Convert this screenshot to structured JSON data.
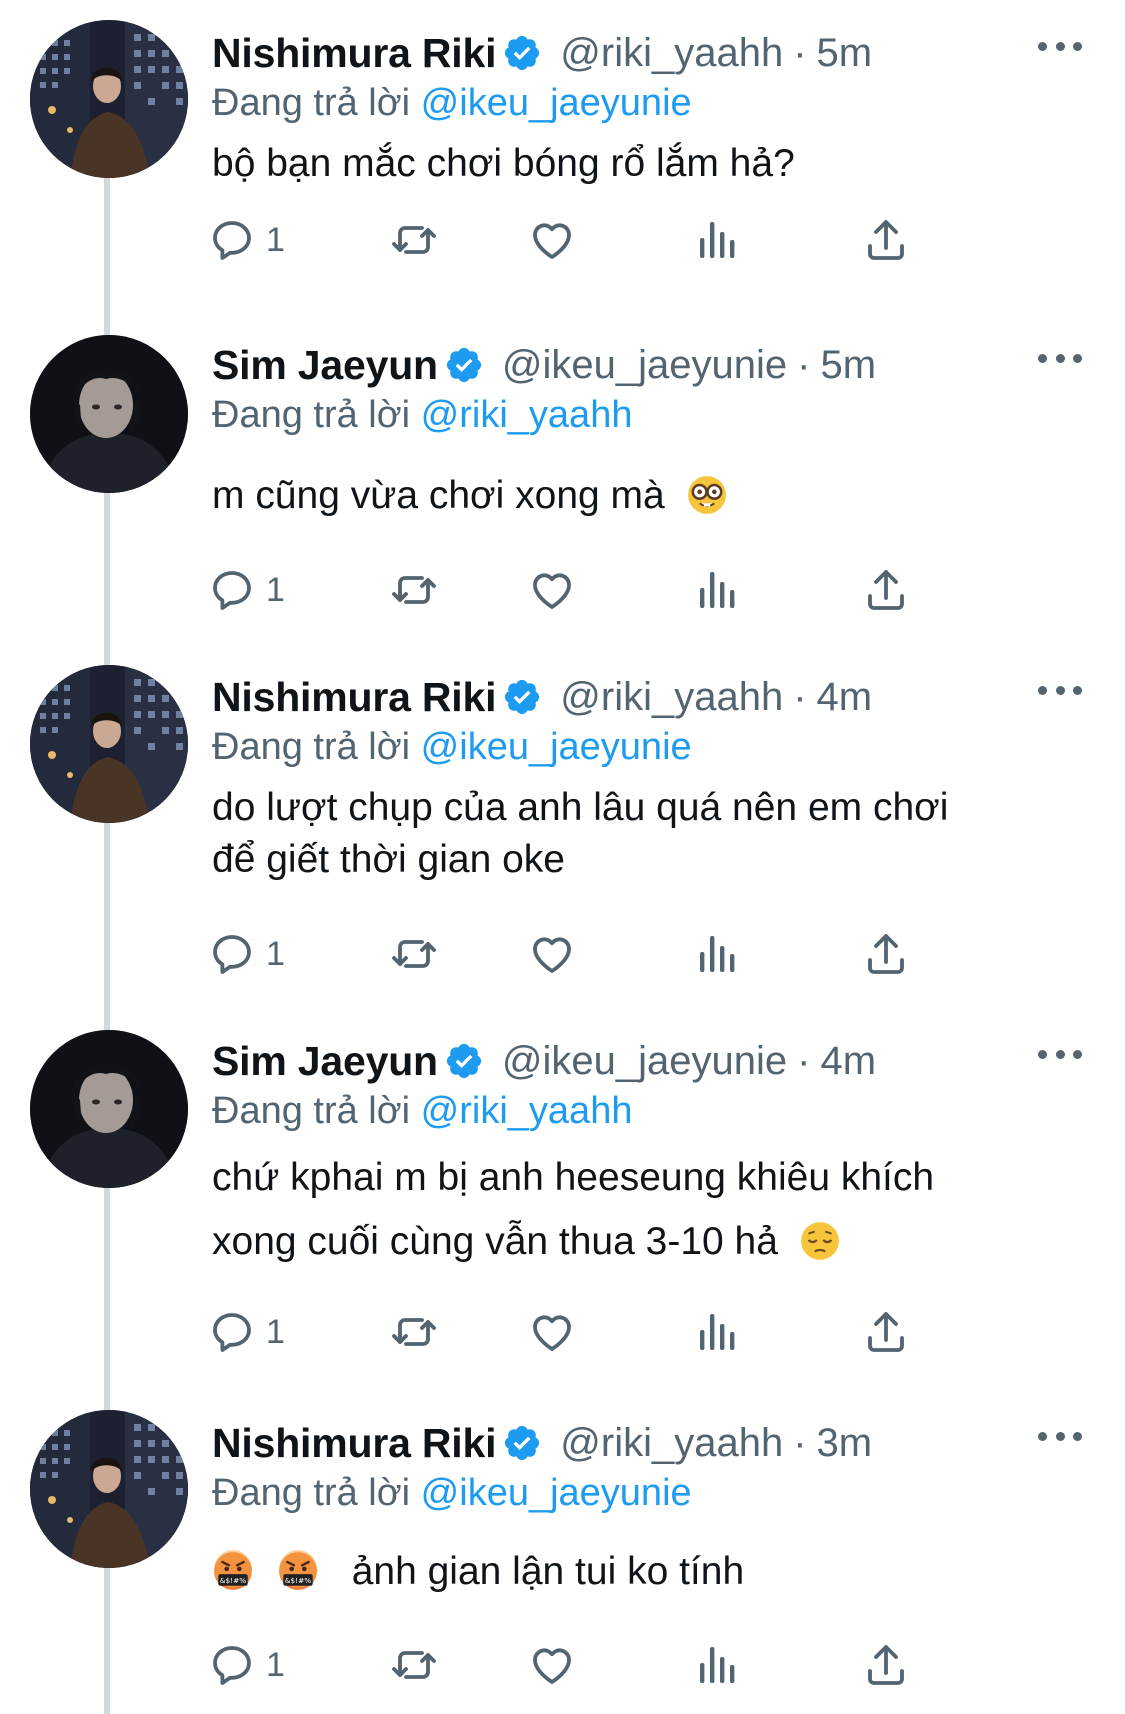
{
  "colors": {
    "text": "#0f1419",
    "secondary": "#536471",
    "accent": "#1d9bf0",
    "thread_line": "#cfd9de"
  },
  "tweets": [
    {
      "name": "Nishimura Riki",
      "handle": "@riki_yaahh",
      "separator": "·",
      "time": "5m",
      "reply_prefix": "Đang trả lời",
      "reply_to": "@ikeu_jaeyunie",
      "lines": [
        "bộ bạn mắc chơi bóng rổ lắm hả?"
      ],
      "reply_count": "1",
      "avatar_icon": "riki-avatar"
    },
    {
      "name": "Sim Jaeyun",
      "handle": "@ikeu_jaeyunie",
      "separator": "·",
      "time": "5m",
      "reply_prefix": "Đang trả lời",
      "reply_to": "@riki_yaahh",
      "lines": [
        "m cũng vừa chơi xong mà"
      ],
      "emoji": "nerd-face-emoji",
      "reply_count": "1",
      "avatar_icon": "jaeyun-avatar"
    },
    {
      "name": "Nishimura Riki",
      "handle": "@riki_yaahh",
      "separator": "·",
      "time": "4m",
      "reply_prefix": "Đang trả lời",
      "reply_to": "@ikeu_jaeyunie",
      "lines": [
        "do lượt chụp của anh lâu quá nên em chơi",
        "để giết thời gian oke"
      ],
      "reply_count": "1",
      "avatar_icon": "riki-avatar"
    },
    {
      "name": "Sim Jaeyun",
      "handle": "@ikeu_jaeyunie",
      "separator": "·",
      "time": "4m",
      "reply_prefix": "Đang trả lời",
      "reply_to": "@riki_yaahh",
      "lines": [
        "chứ kphai m bị anh heeseung khiêu khích",
        "xong cuối cùng vẫn thua 3-10 hả"
      ],
      "emoji": "pensive-face-emoji",
      "reply_count": "1",
      "avatar_icon": "jaeyun-avatar"
    },
    {
      "name": "Nishimura Riki",
      "handle": "@riki_yaahh",
      "separator": "·",
      "time": "3m",
      "reply_prefix": "Đang trả lời",
      "reply_to": "@ikeu_jaeyunie",
      "lines": [
        "ảnh gian lận tui ko tính"
      ],
      "lead_emoji": [
        "cursing-face-emoji",
        "cursing-face-emoji"
      ],
      "reply_count": "1",
      "avatar_icon": "riki-avatar"
    }
  ]
}
